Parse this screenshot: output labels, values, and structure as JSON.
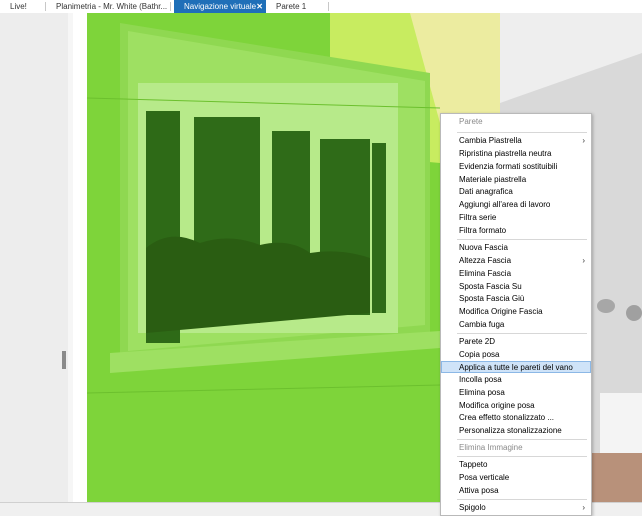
{
  "tabs": [
    {
      "label": "Live!",
      "active": false
    },
    {
      "label": "Planimetria - Mr. White (Bathr...",
      "active": false
    },
    {
      "label": "Navigazione virtuale",
      "active": true,
      "close": "✕"
    },
    {
      "label": "Parete 1",
      "active": false
    }
  ],
  "menu": {
    "header": "Parete",
    "group1": [
      {
        "label": "Cambia Piastrella",
        "submenu": "›"
      },
      {
        "label": "Ripristina piastrella neutra"
      },
      {
        "label": "Evidenzia formati sostituibili"
      },
      {
        "label": "Materiale piastrella"
      },
      {
        "label": "Dati anagrafica"
      },
      {
        "label": "Aggiungi all'area di lavoro"
      },
      {
        "label": "Filtra serie"
      },
      {
        "label": "Filtra formato"
      }
    ],
    "group2": [
      {
        "label": "Nuova Fascia"
      },
      {
        "label": "Altezza Fascia",
        "submenu": "›"
      },
      {
        "label": "Elimina Fascia"
      },
      {
        "label": "Sposta Fascia Su"
      },
      {
        "label": "Sposta Fascia Giù"
      },
      {
        "label": "Modifica Origine Fascia"
      },
      {
        "label": "Cambia fuga"
      }
    ],
    "group3": [
      {
        "label": "Parete 2D"
      },
      {
        "label": "Copia posa"
      },
      {
        "label": "Applica a tutte le pareti del vano",
        "highlighted": true
      },
      {
        "label": "Incolla posa"
      },
      {
        "label": "Elimina posa"
      },
      {
        "label": "Modifica origine posa"
      },
      {
        "label": "Crea effetto stonalizzato ..."
      },
      {
        "label": "Personalizza stonalizzazione"
      }
    ],
    "group4": [
      {
        "label": "Elimina Immagine",
        "disabled": true
      }
    ],
    "group5": [
      {
        "label": "Tappeto"
      },
      {
        "label": "Posa verticale"
      },
      {
        "label": "Attiva posa"
      }
    ],
    "group6": [
      {
        "label": "Spigolo",
        "submenu": "›"
      }
    ]
  },
  "colors": {
    "accent_tab": "#1f6fb8",
    "wall_highlight": "#7ed43a",
    "menu_highlight": "#cfe3f8"
  }
}
